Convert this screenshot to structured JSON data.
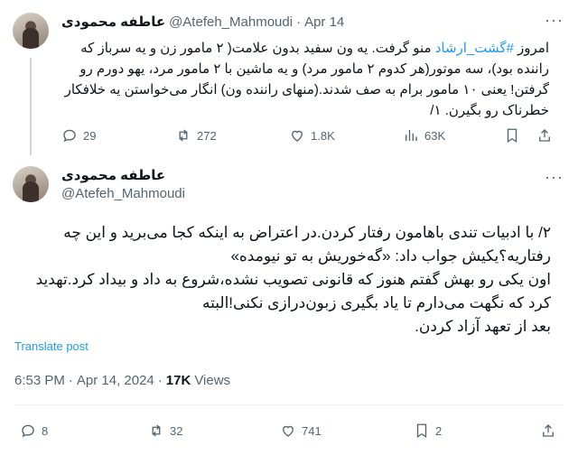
{
  "tweet1": {
    "display_name": "عاطفه محمودی",
    "handle": "@Atefeh_Mahmoudi",
    "separator": "·",
    "date": "Apr 14",
    "more": "···",
    "text_prefix": "امروز ",
    "hashtag": "#گشت_ارشاد",
    "text_rest": " منو گرفت. یه ون سفید بدون علامت( ۲ مامور زن و یه سرباز که راننده بود)، سه موتور(هر کدوم ۲ مامور مرد) و یه ماشین با ۲ مامور مرد، یهو دورم رو گرفتن! یعنی ۱۰ مامور برام به صف شدند.(منهای راننده ون) انگار می‌خواستن یه خلافکار خطرناک رو بگیرن. ۱/",
    "stats": {
      "replies": "29",
      "reposts": "272",
      "likes": "1.8K",
      "views": "63K"
    }
  },
  "tweet2": {
    "display_name": "عاطفه محمودی",
    "handle": "@Atefeh_Mahmoudi",
    "more": "···",
    "line1": "۲/ با ادبیات تندی باهامون رفتار کردن.در اعتراض به اینکه کجا می‌برید و این چه رفتاریه؟یکیش جواب داد: «گه‌خوریش به تو نیومده»",
    "line2": "اون یکی رو بهش گفتم هنوز که قانونی تصویب نشده،شروع به داد و بیداد کرد.تهدید کرد که نگهت می‌دارم تا یاد بگیری زبون‌درازی نکنی!البته",
    "line3": "بعد از تعهد آزاد کردن.",
    "translate": "Translate post",
    "time": "6:53 PM",
    "separator": "·",
    "date": "Apr 14, 2024",
    "views_count": "17K",
    "views_label": "Views",
    "stats": {
      "replies": "8",
      "reposts": "32",
      "likes": "741",
      "bookmarks": "2"
    }
  }
}
